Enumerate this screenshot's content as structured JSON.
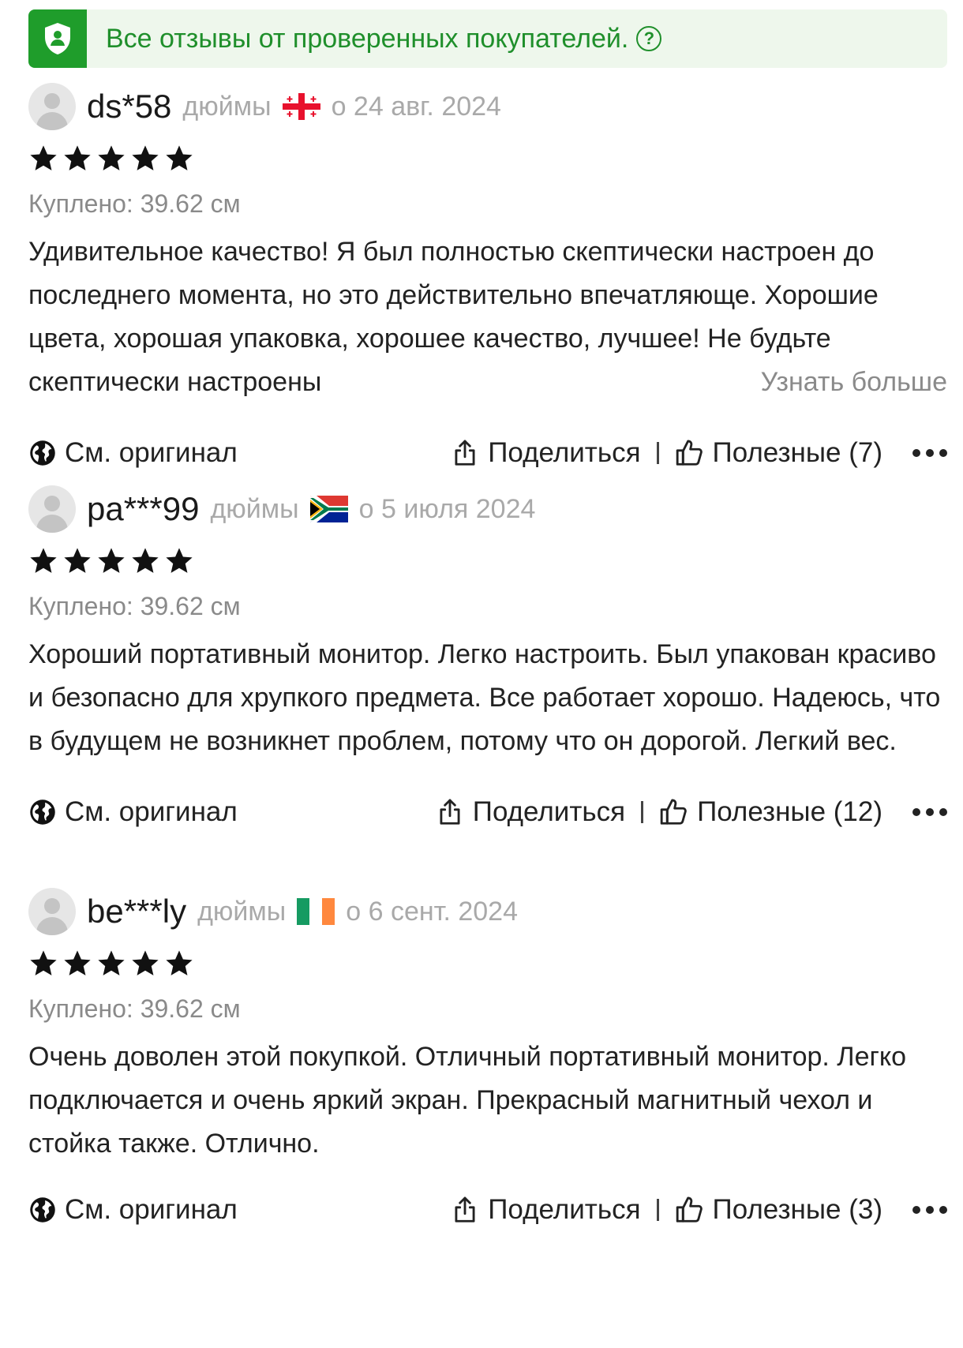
{
  "banner": {
    "text": "Все отзывы от проверенных покупателей.",
    "help_glyph": "?",
    "accent_color": "#1f9d2b"
  },
  "reviews": [
    {
      "username": "ds*58",
      "unit": "дюймы",
      "flag": "flag-georgia-icon",
      "date": "о 24 авг. 2024",
      "rating": 5,
      "bought": "Куплено: 39.62 см",
      "text": "Удивительное качество! Я был полностью скептически настроен до последнего момента, но это действительно впечатляюще. Хорошие цвета, хорошая упаковка, хорошее качество, лучшее! Не будьте скептически настроены",
      "more_label": "Узнать больше",
      "original_label": "См. оригинал",
      "share_label": "Поделиться",
      "helpful_label": "Полезные (7)"
    },
    {
      "username": "pa***99",
      "unit": "дюймы",
      "flag": "flag-south-africa-icon",
      "date": "о 5 июля 2024",
      "rating": 5,
      "bought": "Куплено: 39.62 см",
      "text": "Хороший портативный монитор. Легко настроить. Был упакован красиво и безопасно для хрупкого предмета. Все работает хорошо. Надеюсь, что в будущем не возникнет проблем, потому что он дорогой. Легкий вес.",
      "original_label": "См. оригинал",
      "share_label": "Поделиться",
      "helpful_label": "Полезные (12)"
    },
    {
      "username": "be***ly",
      "unit": "дюймы",
      "flag": "flag-ireland-icon",
      "date": "о 6 сент. 2024",
      "rating": 5,
      "bought": "Куплено: 39.62 см",
      "text": "Очень доволен этой покупкой. Отличный портативный монитор. Легко подключается и очень яркий экран. Прекрасный магнитный чехол и стойка также. Отлично.",
      "original_label": "См. оригинал",
      "share_label": "Поделиться",
      "helpful_label": "Полезные (3)"
    }
  ]
}
